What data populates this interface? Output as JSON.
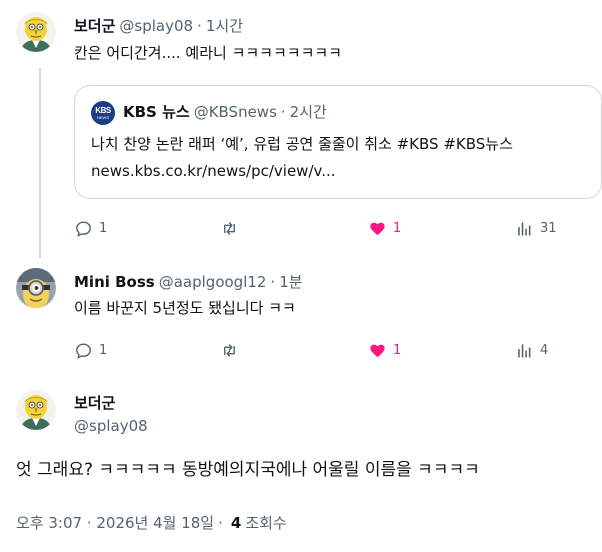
{
  "thread": [
    {
      "author": {
        "name": "보더군",
        "handle": "@splay08",
        "avatar": "mr-burns-cartoon-avatar"
      },
      "time": "1시간",
      "text": "칸은 어디간겨.... 예라니 ㅋㅋㅋㅋㅋㅋㅋㅋ",
      "quote": {
        "author": {
          "name": "KBS 뉴스",
          "handle": "@KBSnews",
          "logo_top": "KBS",
          "logo_bottom": "NEWS"
        },
        "time": "2시간",
        "text": "나치 찬양 논란 래퍼 ‘예’, 유럽 공연 줄줄이 취소 #KBS #KBS뉴스",
        "link": "news.kbs.co.kr/news/pc/view/v..."
      },
      "actions": {
        "replies": "1",
        "reposts": "",
        "likes": "1",
        "liked": true,
        "views": "31"
      }
    },
    {
      "author": {
        "name": "Mini Boss",
        "handle": "@aaplgoogl12",
        "avatar": "minion-character-avatar"
      },
      "time": "1분",
      "text": "이름 바꾼지 5년정도 됐십니다 ㅋㅋ",
      "actions": {
        "replies": "1",
        "reposts": "",
        "likes": "1",
        "liked": true,
        "views": "4"
      }
    }
  ],
  "main_post": {
    "author": {
      "name": "보더군",
      "handle": "@splay08",
      "avatar": "mr-burns-cartoon-avatar"
    },
    "text": "엇 그래요? ㅋㅋㅋㅋㅋ 동방예의지국에나 어울릴 이름을 ㅋㅋㅋㅋ",
    "timestamp": "오후 3:07 · 2026년 4월 18일",
    "views_count": "4",
    "views_label": "조회수"
  },
  "colors": {
    "like": "#f91880",
    "secondary_text": "#536471",
    "border": "#cfd9de",
    "brand_kbs": "#1d3c87"
  },
  "icons": [
    "reply-icon",
    "repost-icon",
    "like-icon",
    "views-icon"
  ]
}
